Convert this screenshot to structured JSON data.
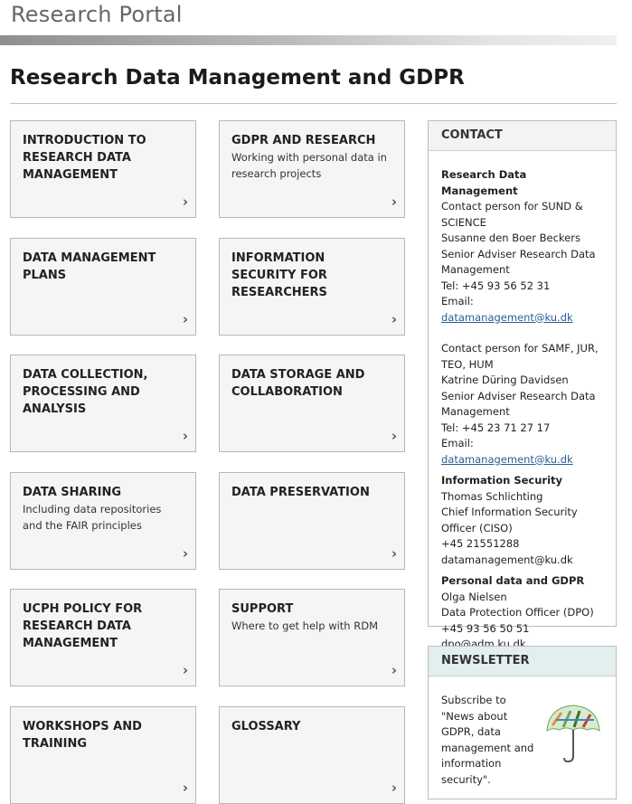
{
  "header": {
    "portal_title": "Research Portal"
  },
  "page_title": "Research Data Management and GDPR",
  "tiles": [
    {
      "title": "INTRODUCTION TO RESEARCH DATA MANAGEMENT",
      "subtitle": ""
    },
    {
      "title": "GDPR AND RESEARCH",
      "subtitle": "Working with personal data in research projects"
    },
    {
      "title": "DATA MANAGEMENT PLANS",
      "subtitle": ""
    },
    {
      "title": "INFORMATION SECURITY FOR RESEARCHERS",
      "subtitle": ""
    },
    {
      "title": "DATA COLLECTION, PROCESSING AND ANALYSIS",
      "subtitle": ""
    },
    {
      "title": "DATA STORAGE AND COLLABORATION",
      "subtitle": ""
    },
    {
      "title": "DATA SHARING",
      "subtitle": "Including data repositories and the FAIR principles"
    },
    {
      "title": "DATA PRESERVATION",
      "subtitle": ""
    },
    {
      "title": "UCPH POLICY FOR RESEARCH DATA MANAGEMENT",
      "subtitle": ""
    },
    {
      "title": "SUPPORT",
      "subtitle": "Where to get help with RDM"
    },
    {
      "title": "WORKSHOPS AND TRAINING",
      "subtitle": ""
    },
    {
      "title": "GLOSSARY",
      "subtitle": ""
    }
  ],
  "chevron": "›",
  "contact": {
    "heading": "CONTACT",
    "rdm": {
      "title": "Research Data Management",
      "p1_role": "Contact person for SUND & SCIENCE",
      "p1_name": "Susanne den Boer Beckers",
      "p1_position": "Senior Adviser Research Data Management",
      "p1_tel": "Tel: +45 93 56 52 31",
      "p1_email_label": "Email: ",
      "p1_email": "datamanagement@ku.dk",
      "p2_role": "Contact person for SAMF, JUR, TEO, HUM",
      "p2_name": "Katrine Düring Davidsen",
      "p2_position": "Senior Adviser Research Data Management",
      "p2_tel": "Tel: +45 23 71 27 17",
      "p2_email_label": "Email: ",
      "p2_email": "datamanagement@ku.dk"
    },
    "infosec": {
      "title": "Information Security",
      "name": "Thomas Schlichting",
      "position": "Chief Information Security Officer (CISO)",
      "phone": "+45 21551288",
      "email": "datamanagement@ku.dk"
    },
    "gdpr": {
      "title": "Personal data and GDPR",
      "name": "Olga Nielsen",
      "position": "Data Protection Officer (DPO)",
      "phone": "+45 93 56 50 51",
      "email": "dpo@adm.ku.dk"
    }
  },
  "newsletter": {
    "heading": "NEWSLETTER",
    "text": "Subscribe to \"News about GDPR, data management and information security\".",
    "image_icon": "umbrella-word-cloud-icon"
  }
}
